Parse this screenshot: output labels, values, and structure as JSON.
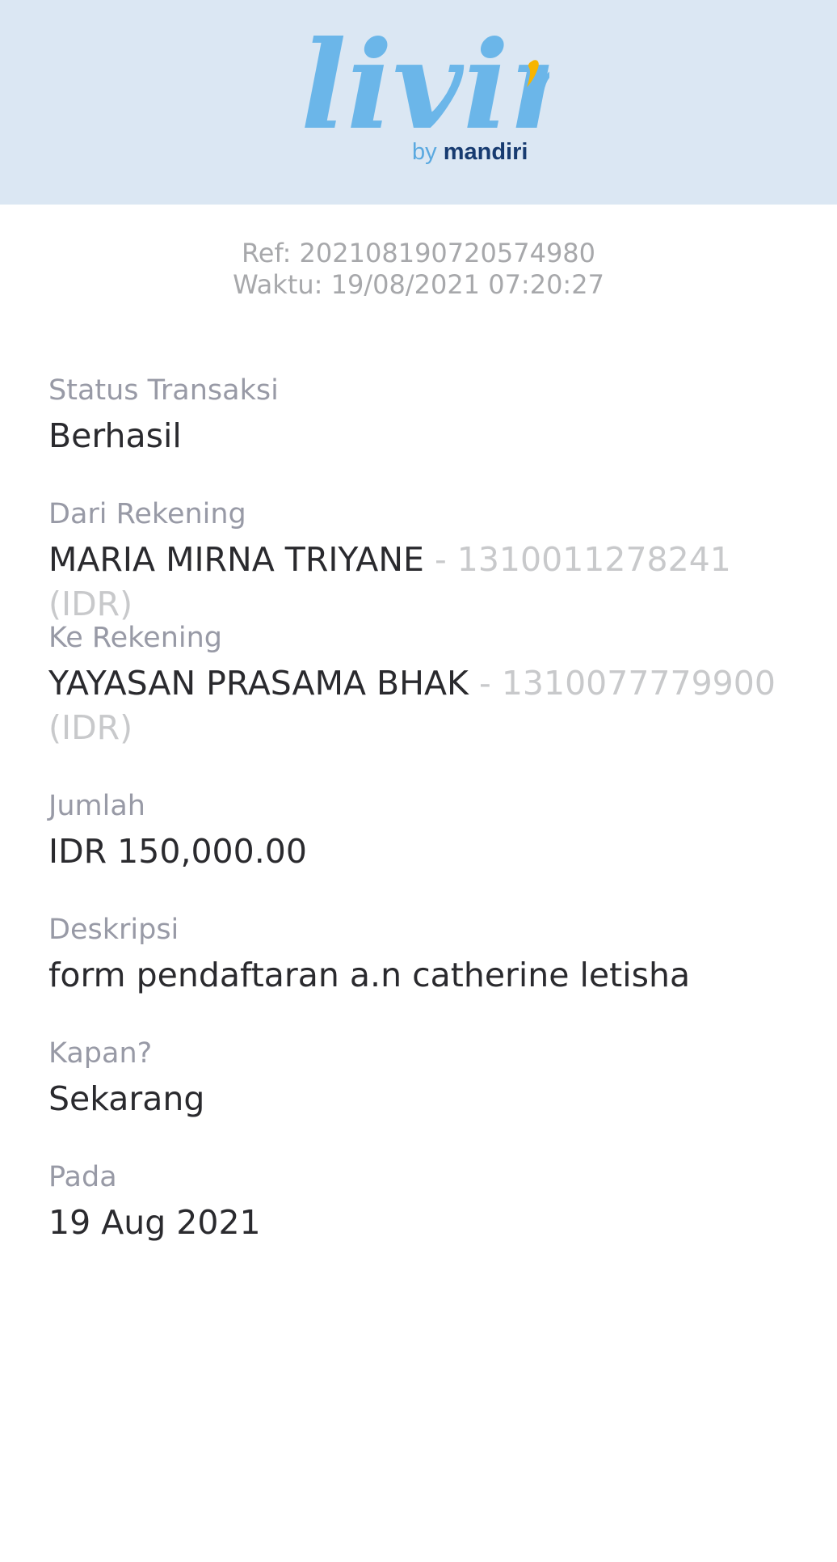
{
  "header": {
    "logo_text": "livin'",
    "tagline_by": "by",
    "tagline_brand": "mandiri",
    "background_color": "#dbe7f3",
    "logo_color": "#6bb6e9",
    "accent_color": "#f7b500"
  },
  "receipt": {
    "ref": "Ref: 202108190720574980",
    "time": "Waktu: 19/08/2021 07:20:27"
  },
  "fields": {
    "status": {
      "label": "Status Transaksi",
      "value": "Berhasil"
    },
    "from": {
      "label": "Dari Rekening",
      "name": "MARIA MIRNA TRIYANE",
      "account": " - 1310011278241 (IDR)"
    },
    "to": {
      "label": "Ke Rekening",
      "name": "YAYASAN PRASAMA BHAK",
      "account": " - 1310077779900 (IDR)"
    },
    "amount": {
      "label": "Jumlah",
      "value": "IDR 150,000.00"
    },
    "description": {
      "label": "Deskripsi",
      "value": "form pendaftaran a.n catherine letisha"
    },
    "when": {
      "label": "Kapan?",
      "value": "Sekarang"
    },
    "on": {
      "label": "Pada",
      "value": "19 Aug 2021"
    }
  }
}
